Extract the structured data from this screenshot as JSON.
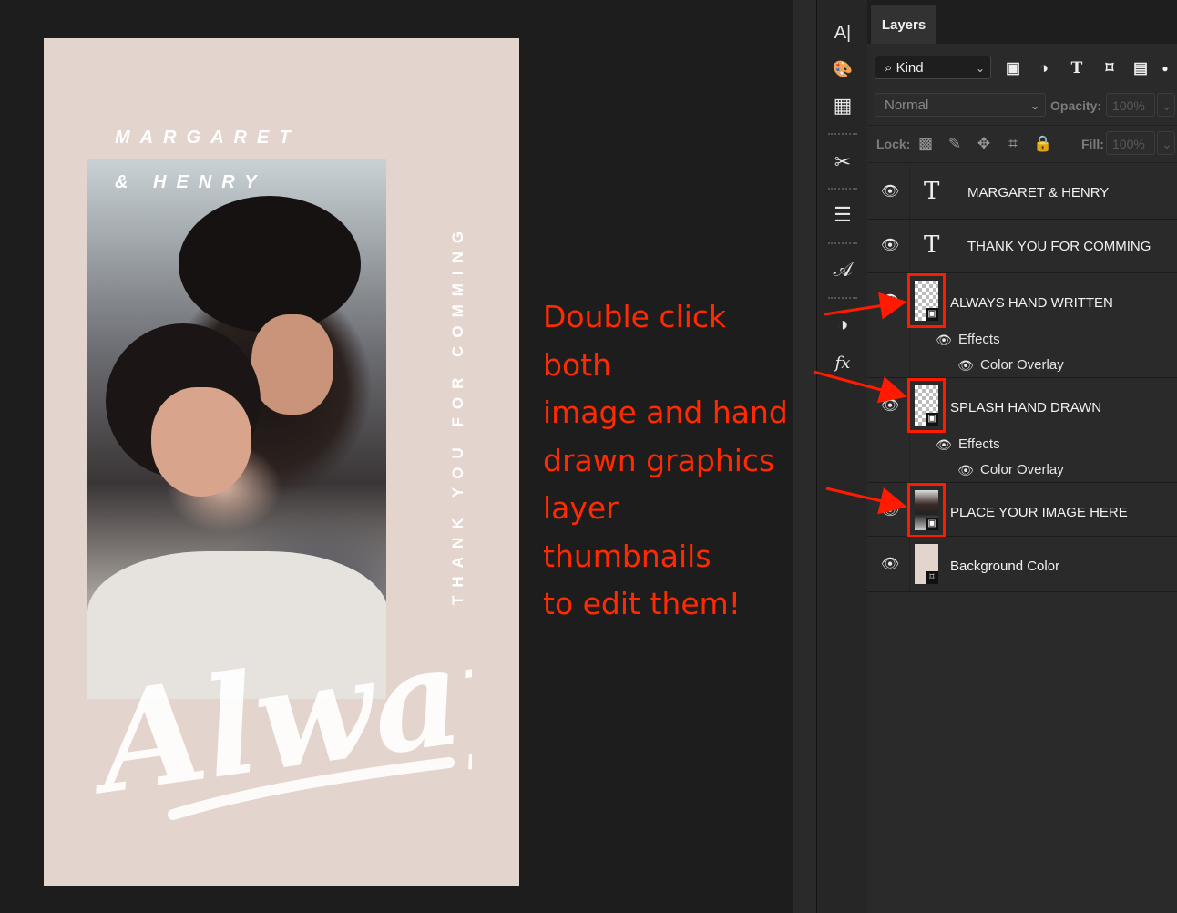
{
  "canvas": {
    "title_line1": "MARGARET",
    "title_line2": "& HENRY",
    "vertical_text": "THANK YOU FOR COMMING",
    "script_word": "Always"
  },
  "annotation": {
    "lines": [
      "Double click both",
      "image and hand",
      "drawn graphics",
      "layer thumbnails",
      "to edit them!"
    ],
    "color": "#ff2a00"
  },
  "toolbar": {
    "tools": [
      {
        "icon": "type-cursor-icon",
        "glyph": "A|"
      },
      {
        "icon": "palette-icon",
        "glyph": "🎨"
      },
      {
        "icon": "grid-icon",
        "glyph": "▦"
      },
      {
        "icon": "scissors-icon",
        "glyph": "✂"
      },
      {
        "icon": "paragraph-panel-icon",
        "glyph": "☰"
      },
      {
        "icon": "glyph-panel-icon",
        "glyph": "𝒜"
      },
      {
        "icon": "adjustments-icon",
        "glyph": "◑"
      },
      {
        "icon": "fx-styles-icon",
        "glyph": "fx"
      }
    ]
  },
  "panel": {
    "tab_label": "Layers",
    "filter": {
      "kind_label": "Kind",
      "search_glyph": "⌕"
    },
    "blend_mode": "Normal",
    "opacity_label": "Opacity:",
    "opacity_value": "100%",
    "lock_label": "Lock:",
    "fill_label": "Fill:",
    "fill_value": "100%"
  },
  "layers": [
    {
      "name": "MARGARET & HENRY",
      "kind": "text",
      "type_glyph": "T"
    },
    {
      "name": "THANK YOU FOR COMMING",
      "kind": "text",
      "type_glyph": "T"
    },
    {
      "name": "ALWAYS HAND WRITTEN",
      "kind": "smart",
      "effects_label": "Effects",
      "effect_name": "Color Overlay",
      "highlighted": true
    },
    {
      "name": "SPLASH HAND DRAWN",
      "kind": "smart",
      "effects_label": "Effects",
      "effect_name": "Color Overlay",
      "highlighted": true
    },
    {
      "name": "PLACE YOUR IMAGE HERE",
      "kind": "smart-photo",
      "highlighted": true
    },
    {
      "name": "Background Color",
      "kind": "fill"
    }
  ]
}
